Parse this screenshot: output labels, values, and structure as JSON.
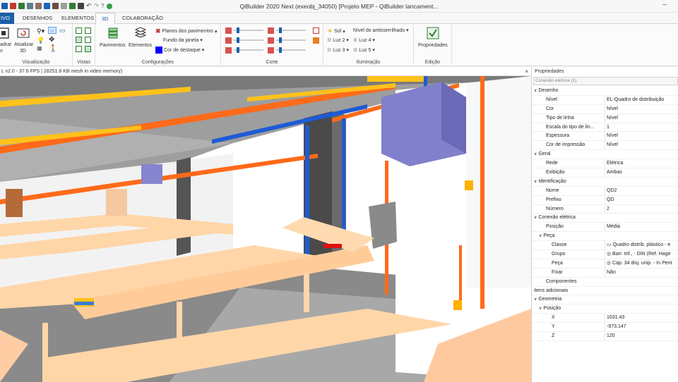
{
  "window": {
    "title": "QiBuilder 2020 Next (exeobj_34050) [Projeto MEP - QiBuilder lancament...",
    "minimize": "–"
  },
  "tabs": {
    "file": "IVO",
    "items": [
      "DESENHOS",
      "ELEMENTOS",
      "3D",
      "COLABORAÇÃO"
    ],
    "active": "3D"
  },
  "ribbon": {
    "visualizacao": {
      "label": "Visualização",
      "enquadrar": "adrar",
      "enquadrar2": "o",
      "atualizar": "Atualizar",
      "atualizar2": "3D"
    },
    "vistas": {
      "label": "Vistas"
    },
    "configuracoes": {
      "label": "Configurações",
      "pavimentos": "Pavimentos",
      "elementos": "Elementos",
      "planos": "Planos dos pavimentos",
      "fundo": "Fundo da janela",
      "destaque": "Cor de destaque"
    },
    "corte": {
      "label": "Corte"
    },
    "iluminacao": {
      "label": "Iluminação",
      "sol": "Sol",
      "antisserrilhado": "Nível do antisserrilhado",
      "luz2": "Luz 2",
      "luz4": "Luz 4",
      "luz3": "Luz 3",
      "luz5": "Luz 5"
    },
    "edicao": {
      "label": "Edição",
      "propriedades": "Propriedades"
    }
  },
  "status": {
    "text": "L v2.0 - 37.6 FPS | 28251.8 KB mesh in video memory)",
    "close": "×"
  },
  "properties": {
    "title": "Propriedades",
    "selection": "Conexão elétrica (1)",
    "rows": [
      {
        "name": "Desenho",
        "value": "",
        "type": "cat",
        "level": 0
      },
      {
        "name": "Nível",
        "value": "EL-Quadro de distribuição",
        "type": "prop",
        "level": 1
      },
      {
        "name": "Cor",
        "value": "Nível",
        "type": "prop",
        "level": 1
      },
      {
        "name": "Tipo de linha",
        "value": "Nível",
        "type": "prop",
        "level": 1
      },
      {
        "name": "Escala do tipo de lin...",
        "value": "1",
        "type": "prop",
        "level": 1
      },
      {
        "name": "Espessura",
        "value": "Nível",
        "type": "prop",
        "level": 1
      },
      {
        "name": "Cor de impressão",
        "value": "Nível",
        "type": "prop",
        "level": 1
      },
      {
        "name": "Geral",
        "value": "",
        "type": "cat",
        "level": 0
      },
      {
        "name": "Rede",
        "value": "Elétrica",
        "type": "prop",
        "level": 1
      },
      {
        "name": "Exibição",
        "value": "Ambas",
        "type": "prop",
        "level": 1
      },
      {
        "name": "Identificação",
        "value": "",
        "type": "cat",
        "level": 0
      },
      {
        "name": "Nome",
        "value": "QD2",
        "type": "prop",
        "level": 1
      },
      {
        "name": "Prefixo",
        "value": "QD",
        "type": "prop",
        "level": 1
      },
      {
        "name": "Número",
        "value": "2",
        "type": "prop",
        "level": 1
      },
      {
        "name": "Conexão elétrica",
        "value": "",
        "type": "cat",
        "level": 0
      },
      {
        "name": "Posição",
        "value": "Média",
        "type": "prop",
        "level": 1
      },
      {
        "name": "Peça",
        "value": "",
        "type": "subcat",
        "level": 1
      },
      {
        "name": "Classe",
        "value": "▭ Quadro distrib. plástico - e",
        "type": "prop",
        "level": 2
      },
      {
        "name": "Grupo",
        "value": "◎ Barr. trif., - DIN (Ref. Hage",
        "type": "prop",
        "level": 2
      },
      {
        "name": "Peça",
        "value": "◎ Cap. 34 disj. unip. - In Pent",
        "type": "prop",
        "level": 2
      },
      {
        "name": "Fixar",
        "value": "Não",
        "type": "prop",
        "level": 2
      },
      {
        "name": "Componentes",
        "value": "",
        "type": "prop",
        "level": 1
      },
      {
        "name": "Itens adicionais",
        "value": "",
        "type": "prop",
        "level": 0
      },
      {
        "name": "Geometria",
        "value": "",
        "type": "cat",
        "level": 0
      },
      {
        "name": "Posição",
        "value": "",
        "type": "subcat",
        "level": 1
      },
      {
        "name": "X",
        "value": "1031.43",
        "type": "prop",
        "level": 2
      },
      {
        "name": "Y",
        "value": "-973.147",
        "type": "prop",
        "level": 2
      },
      {
        "name": "Z",
        "value": "120",
        "type": "prop",
        "level": 2
      }
    ]
  },
  "colors": {
    "accent": "#1a5fa8",
    "pipe_orange": "#ff6a1a",
    "pipe_blue": "#1e5bd6",
    "tray_yellow": "#ffc21a",
    "desk": "#ffd6a8",
    "panel_purple": "#8080cc"
  }
}
